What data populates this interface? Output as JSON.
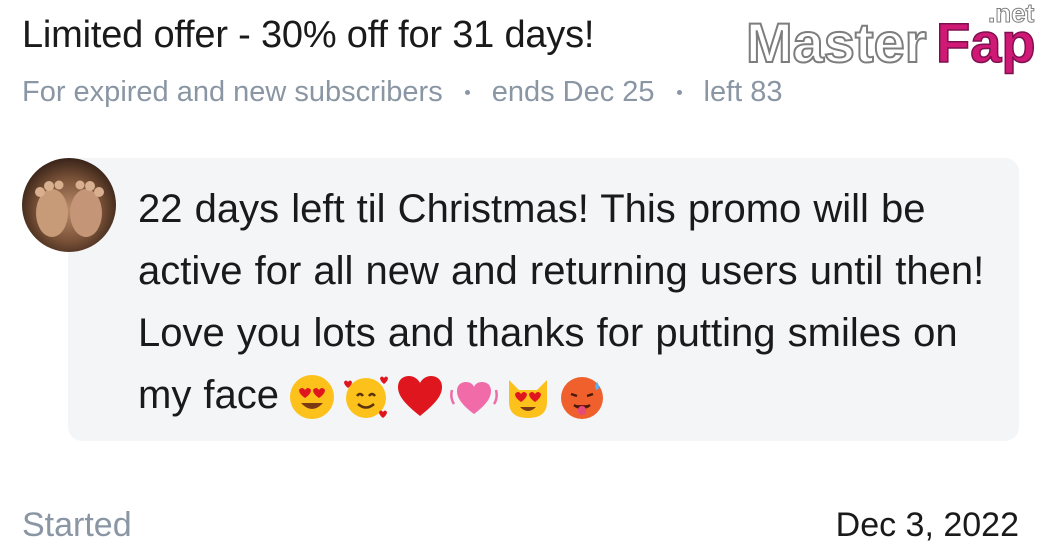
{
  "offer": {
    "title": "Limited offer - 30% off for 31 days!",
    "audience": "For expired and new subscribers",
    "ends": "ends Dec 25",
    "left": "left 83"
  },
  "watermark": {
    "text": "MasterFap",
    "suffix": ".net"
  },
  "message": {
    "text": "22 days left til Christmas! This promo will be active for all new and returning users until then! Love you lots and thanks for putting smiles on my face",
    "emojis": [
      "heart-eyes-emoji",
      "smiling-face-with-hearts-emoji",
      "red-heart-emoji",
      "beating-heart-emoji",
      "heart-eyes-cat-emoji",
      "hot-face-emoji"
    ]
  },
  "footer": {
    "label": "Started",
    "value": "Dec 3, 2022"
  },
  "colors": {
    "muted_text": "#8a96a3",
    "bubble_bg": "#f3f5f7",
    "heart_red": "#e0161f",
    "watermark_pink": "#d01875"
  }
}
